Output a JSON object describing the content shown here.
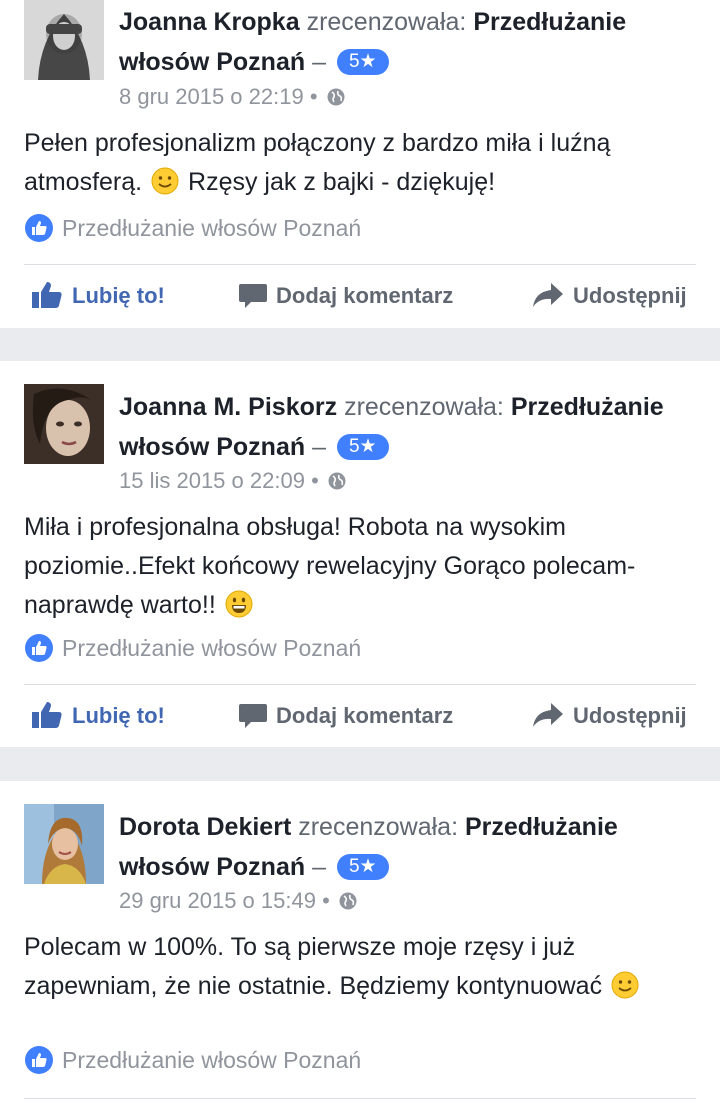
{
  "colors": {
    "accent": "#4267b2",
    "badge": "#4080ff",
    "muted": "#90949c",
    "background": "#e9ebee"
  },
  "actions": {
    "like": "Lubię to!",
    "comment": "Dodaj komentarz",
    "share": "Udostępnij"
  },
  "reviews": [
    {
      "reviewer": "Joanna Kropka",
      "verb": "zrecenzowała:",
      "page": "Przedłużanie włosów Poznań",
      "dash": "–",
      "rating": "5★",
      "date": "8 gru 2015 o 22:19",
      "text_before": "Pełen profesjonalizm połączony z  bardzo miła i luźną atmosferą. ",
      "text_after": " Rzęsy jak z bajki - dziękuję!",
      "emoji_icon": "slight-smile-emoji-icon",
      "tag": "Przedłużanie włosów Poznań"
    },
    {
      "reviewer": "Joanna M. Piskorz",
      "verb": "zrecenzowała:",
      "page": "Przedłużanie włosów Poznań",
      "dash": "–",
      "rating": "5★",
      "date": "15 lis 2015 o 22:09",
      "text_before": "Miła i profesjonalna obsługa! Robota na wysokim poziomie..Efekt końcowy rewelacyjny  Gorąco polecam- naprawdę warto!!  ",
      "text_after": "",
      "emoji_icon": "grin-emoji-icon",
      "tag": "Przedłużanie włosów Poznań"
    },
    {
      "reviewer": "Dorota Dekiert",
      "verb": "zrecenzowała:",
      "page": "Przedłużanie włosów Poznań",
      "dash": "–",
      "rating": "5★",
      "date": "29 gru 2015 o 15:49",
      "text_before": "Polecam w 100%. To są pierwsze moje rzęsy i już zapewniam, że nie ostatnie. Będziemy kontynuować ",
      "text_after": "",
      "emoji_icon": "slight-smile-emoji-icon",
      "tag": "Przedłużanie włosów Poznań"
    }
  ]
}
